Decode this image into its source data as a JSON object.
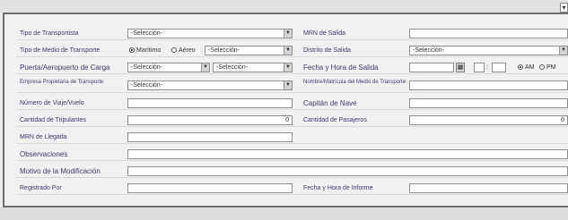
{
  "form": {
    "tipo_transportista": {
      "label": "Tipo de Transportista",
      "value": "-Selección-"
    },
    "mrn_salida": {
      "label": "MRN de Salida",
      "value": ""
    },
    "tipo_medio": {
      "label": "Tipo de Medio de Transporte",
      "option_maritimo": "Marítimo",
      "option_aereo": "Aéreo",
      "selected": "Marítimo",
      "select_value": "-Selección-"
    },
    "distrito_salida": {
      "label": "Distrito de Salida",
      "value": "-Selección-"
    },
    "puerto_carga": {
      "label": "Puerta/Aeropuerto de Carga",
      "value1": "-Selección-",
      "value2": "-Selección-"
    },
    "fecha_salida": {
      "label": "Fecha y Hora de Salida",
      "date": "",
      "hour": "",
      "minute": "",
      "sep": ":",
      "am": "AM",
      "pm": "PM",
      "selected": "AM"
    },
    "empresa_propietaria": {
      "label": "Empresa Propietaria de Transporte",
      "value": "-Selección-"
    },
    "nombre_matricula": {
      "label": "Nombre/Matrícula del Medio de Transporte",
      "value": ""
    },
    "numero_viaje": {
      "label": "Número de Viaje/Vuelo",
      "value": ""
    },
    "capitan": {
      "label": "Capitán de Nave",
      "value": ""
    },
    "cantidad_tripulantes": {
      "label": "Cantidad de Tripulantes",
      "value": "0"
    },
    "cantidad_pasajeros": {
      "label": "Cantidad de Pasajeros",
      "value": "0"
    },
    "mrn_llegada": {
      "label": "MRN de Llegada",
      "value": ""
    },
    "observaciones": {
      "label": "Observaciones",
      "value": ""
    },
    "motivo": {
      "label": "Motivo de la Modificación",
      "value": ""
    },
    "registrado_por": {
      "label": "Registrado Por",
      "value": ""
    },
    "fecha_informe": {
      "label": "Fecha y Hora de Informe",
      "value": ""
    }
  },
  "icons": {
    "dropdown": "chevron-down-icon",
    "calendar": "calendar-icon",
    "window": "window-control-icon"
  }
}
